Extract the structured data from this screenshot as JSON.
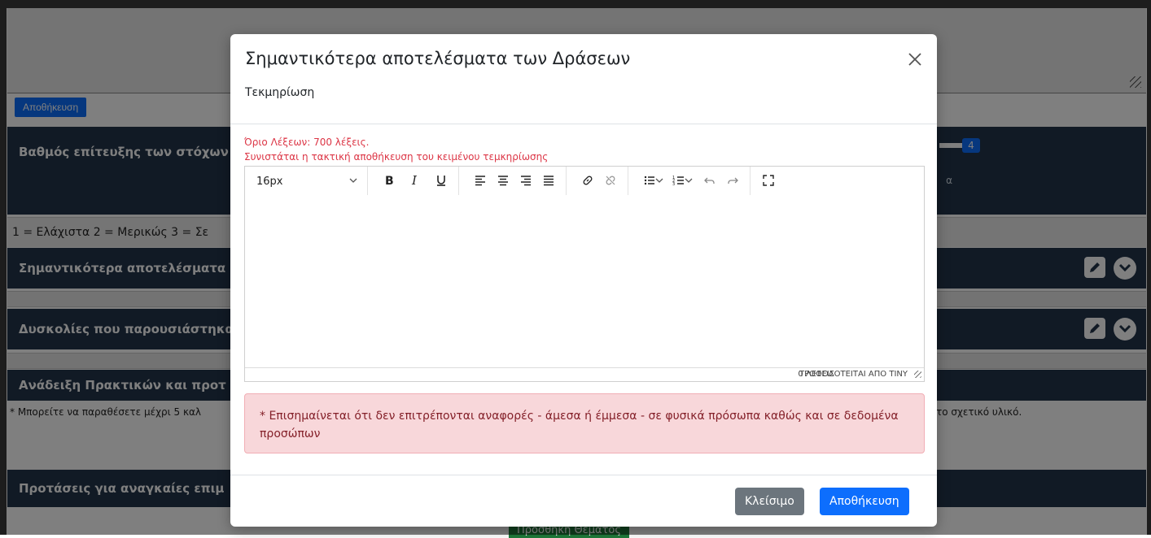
{
  "background": {
    "save_button": "Αποθήκευση",
    "sections": [
      "Βαθμός επίτευξης των στόχων",
      "Σημαντικότερα αποτελέσματα",
      "Δυσκολίες που παρουσιάστηκα",
      "Ανάδειξη Πρακτικών και προτ",
      "Προτάσεις για αναγκαίες επιμ"
    ],
    "scale_text": "1 = Ελάχιστα 2 = Μερικώς 3 = Σε",
    "badge": "4",
    "alpha_fragment": "α",
    "note_left": "* Μπορείτε να παραθέσετε μέχρι 5 καλ",
    "note_right": "το σχετικό υλικό.",
    "add_topic_button": "Προσθήκη Θέματος"
  },
  "modal": {
    "title": "Σημαντικότερα αποτελέσματα των Δράσεων",
    "subtitle": "Τεκμηρίωση",
    "word_limit": "Όριο Λέξεων: 700 λέξεις.",
    "save_hint": "Συνιστάται η τακτική αποθήκευση του κειμένου τεμκηρίωσης",
    "editor": {
      "font_size": "16px",
      "word_count": "0 ΛΕΞΕΙΣ",
      "powered_by": "ΤΡΟΦΟΔΟΤΕΙΤΑΙ ΑΠΟ TINY",
      "content": ""
    },
    "alert": "* Επισημαίνεται ότι δεν επιτρέπονται αναφορές - άμεσα ή έμμεσα - σε φυσικά πρόσωπα καθώς και σε δεδομένα προσώπων",
    "close_button": "Κλείσιμο",
    "save_button": "Αποθήκευση"
  }
}
